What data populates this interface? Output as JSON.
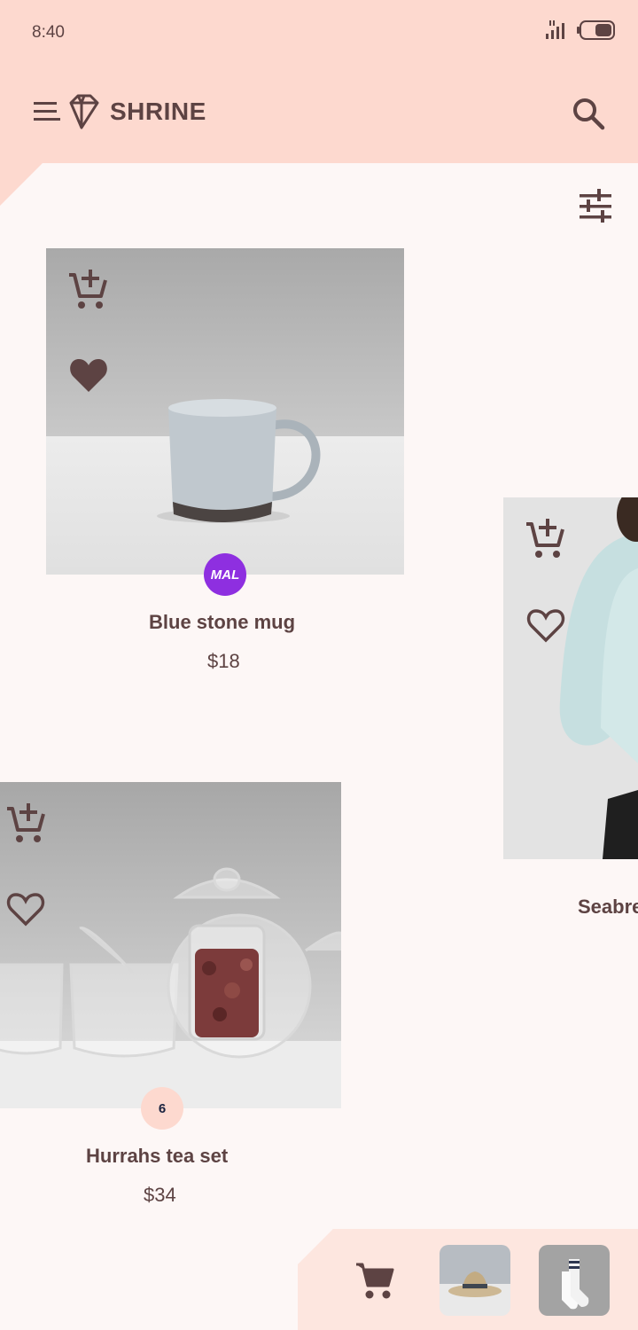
{
  "status_bar": {
    "time": "8:40"
  },
  "app_bar": {
    "title": "SHRINE",
    "icons": [
      "menu-icon",
      "diamond-logo-icon",
      "search-icon"
    ]
  },
  "toolbar": {
    "filter_icon": "tune-icon"
  },
  "products": [
    {
      "name": "Blue stone mug",
      "price": "$18",
      "badge": "MAL",
      "favorited": true,
      "badge_color": "#8e2fe0"
    },
    {
      "name": "Hurrahs tea set",
      "price": "$34",
      "badge": "6",
      "favorited": false,
      "badge_color": "#fdd9cf"
    },
    {
      "name": "Seabre",
      "price": "",
      "badge": "",
      "favorited": false
    }
  ],
  "cart": {
    "icon": "shopping-cart-icon",
    "items": [
      "hat-thumbnail",
      "socks-thumbnail"
    ]
  },
  "colors": {
    "primary": "#fdd9cf",
    "background": "#fdf7f6",
    "on_primary": "#5d4343"
  }
}
